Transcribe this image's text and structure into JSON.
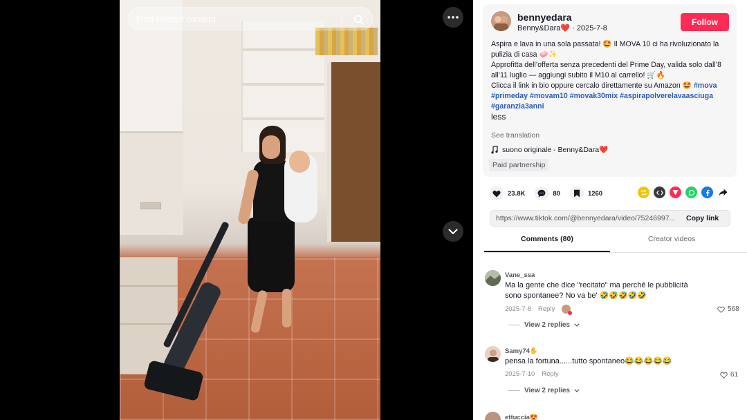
{
  "search": {
    "placeholder": "Find related content"
  },
  "author": {
    "username": "bennyedara",
    "display_name": "Benny&Dara❤️",
    "date": "2025-7-8",
    "follow_label": "Follow"
  },
  "description": {
    "line1": "Aspira e lava in una sola passata! 🤩 Il MOVA 10 ci ha rivoluzionato la pulizia di casa 🧼✨",
    "line2": "Approfitta dell’offerta senza precedenti del Prime Day, valida solo dall’8 all’11 luglio — aggiungi subito il M10 al carrello! 🛒🔥",
    "line3": "Clicca il link in bio oppure cercalo direttamente su Amazon 🤩",
    "hashtags": [
      "#mova",
      "#primeday",
      "#movam10",
      "#movak30mix",
      "#aspirapolverelavaasciuga",
      "#garanzia3anni"
    ],
    "less_label": "less",
    "see_translation": "See translation",
    "sound": "suono originale - Benny&Dara❤️",
    "paid_label": "Paid partnership"
  },
  "stats": {
    "likes": "23.8K",
    "comments": "80",
    "saves": "1260"
  },
  "share": {
    "link": "https://www.tiktok.com/@bennyedara/video/75246997...",
    "copy_label": "Copy link",
    "colors": {
      "repost": "#f5c400",
      "embed": "#3a3a40",
      "send": "#fe2c55",
      "whatsapp": "#25d366",
      "facebook": "#1877f2"
    }
  },
  "tabs": {
    "comments_label": "Comments (80)",
    "creator_label": "Creator videos"
  },
  "comments": [
    {
      "user": "Vane_ssa",
      "text_line1": "Ma la gente che dice \"recitato\" ma perché le pubblicità",
      "text_line2": "sono spontanee? No va be' 🤣🤣🤣🤣🤣",
      "date": "2025-7-8",
      "reply_label": "Reply",
      "likes": "568",
      "replies": "View 2 replies"
    },
    {
      "user": "Samy74✋",
      "text_line1": "pensa la fortuna......tutto spontaneo😂😂😂😂😂",
      "date": "2025-7-10",
      "reply_label": "Reply",
      "likes": "61",
      "replies": "View 2 replies"
    },
    {
      "user": "ettuccia😍"
    }
  ],
  "colors": {
    "accent": "#fe2c55",
    "hashtag": "#2b5db9"
  }
}
